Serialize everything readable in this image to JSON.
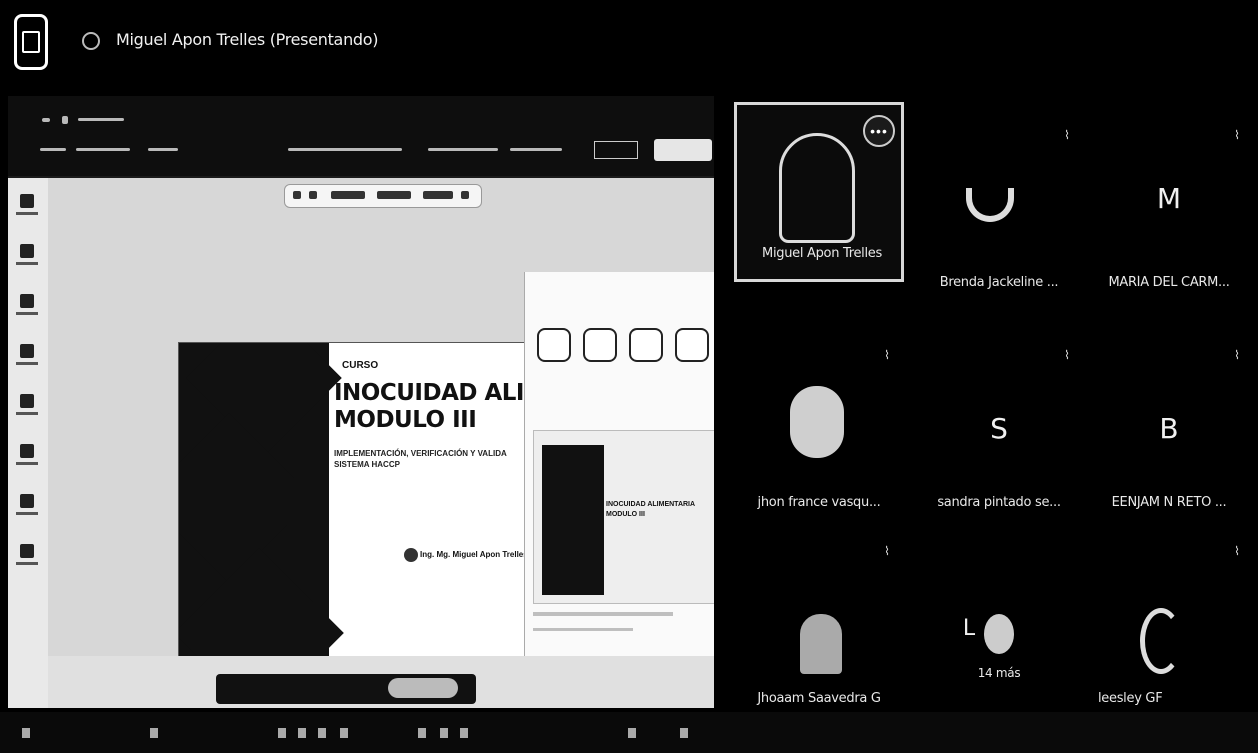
{
  "header": {
    "presenter_title": "Miguel Apon Trelles (Presentando)"
  },
  "icons": {
    "app": "app-logo-icon",
    "share": "share-screen-icon",
    "mic": "mic-off-icon",
    "more": "more-options-icon"
  },
  "shared_screen": {
    "slide": {
      "kicker": "CURSO",
      "title_line1": "INOCUIDAD ALIMENT",
      "title_line2": "MODULO III",
      "subtitle": "IMPLEMENTACIÓN, VERIFICACIÓN Y VALIDA SISTEMA HACCP",
      "author": "Ing. Mg. Miguel Apon Trelles"
    },
    "thumbnail": {
      "title_line1": "INOCUIDAD ALIMENTARIA",
      "title_line2": "MODULO III"
    }
  },
  "participants": [
    {
      "name": "Miguel Apon Trelles",
      "initial": "",
      "active": true
    },
    {
      "name": "Brenda Jackeline ...",
      "initial": "",
      "active": false
    },
    {
      "name": "MARÍA DEL CARM...",
      "initial": "M",
      "active": false
    },
    {
      "name": "jhon france vasqu...",
      "initial": "",
      "active": false
    },
    {
      "name": "sandra pintado se...",
      "initial": "S",
      "active": false
    },
    {
      "name": "EENJAM N RETO ...",
      "initial": "B",
      "active": false
    },
    {
      "name": "Jhoaam Saavedra G",
      "initial": "",
      "active": false
    },
    {
      "name": "14 más",
      "initial": "L",
      "active": false
    },
    {
      "name": "leesley GF",
      "initial": "",
      "active": false
    }
  ],
  "colors": {
    "background": "#000000",
    "text": "#ffffff",
    "active_border": "#d8d8d8"
  }
}
